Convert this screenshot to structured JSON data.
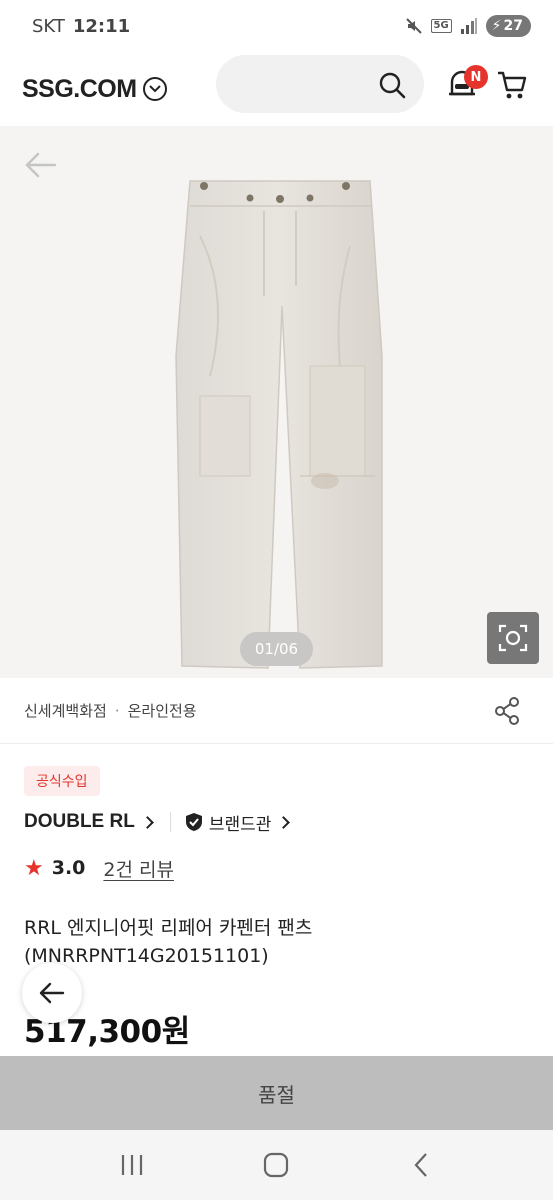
{
  "status": {
    "carrier": "SKT",
    "time": "12:11",
    "network": "5G",
    "battery": "27"
  },
  "header": {
    "logo": "SSG.COM",
    "search_placeholder": "",
    "notification_badge": "N"
  },
  "gallery": {
    "pager": "01/06"
  },
  "store": {
    "name": "신세계백화점",
    "separator": "·",
    "channel": "온라인전용"
  },
  "product": {
    "badge": "공식수입",
    "brand": "DOUBLE RL",
    "brand_hall": "브랜드관",
    "rating": "3.0",
    "reviews": "2건 리뷰",
    "title": "RRL 엔지니어핏 리페어 카펜터 팬츠(MNRRPNT14G20151101)",
    "price": "517,300원"
  },
  "actions": {
    "soldout": "품절"
  },
  "colors": {
    "accent": "#e5342b",
    "soldout_bg": "#bdbdbd"
  }
}
